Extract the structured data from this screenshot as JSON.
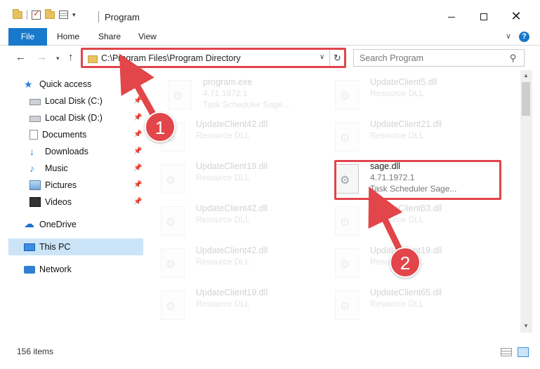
{
  "window": {
    "title": "Program",
    "close_glyph": "✕"
  },
  "ribbon": {
    "tabs": [
      "File",
      "Home",
      "Share",
      "View"
    ],
    "help": "?"
  },
  "navigation": {
    "address": "C:\\Program Files\\Program Directory",
    "search_placeholder": "Search Program"
  },
  "sidebar": {
    "items": [
      {
        "label": "Quick access",
        "icon": "star-icon"
      },
      {
        "label": "Local Disk (C:)",
        "icon": "disk-icon",
        "pinned": true
      },
      {
        "label": "Local Disk (D:)",
        "icon": "disk-icon",
        "pinned": true
      },
      {
        "label": "Documents",
        "icon": "documents-icon",
        "pinned": true
      },
      {
        "label": "Downloads",
        "icon": "download-icon",
        "pinned": true
      },
      {
        "label": "Music",
        "icon": "music-icon",
        "pinned": true
      },
      {
        "label": "Pictures",
        "icon": "pictures-icon",
        "pinned": true
      },
      {
        "label": "Videos",
        "icon": "videos-icon",
        "pinned": true
      },
      {
        "label": "OneDrive",
        "icon": "cloud-icon"
      },
      {
        "label": "This PC",
        "icon": "computer-icon",
        "selected": true
      },
      {
        "label": "Network",
        "icon": "network-icon"
      }
    ]
  },
  "files": [
    {
      "name": "program.exe",
      "version": "4.71.1972.1",
      "desc": "Task Scheduler Sage..."
    },
    {
      "name": "UpdateClient5.dll",
      "version": "Resource DLL",
      "desc": ""
    },
    {
      "name": "UpdateClient42.dll",
      "version": "Resource DLL",
      "desc": ""
    },
    {
      "name": "UpdateClient21.dll",
      "version": "Resource DLL",
      "desc": ""
    },
    {
      "name": "UpdateClient19.dll",
      "version": "Resource DLL",
      "desc": ""
    },
    {
      "name": "sage.dll",
      "version": "4.71.1972.1",
      "desc": "Task Scheduler Sage..."
    },
    {
      "name": "UpdateClient42.dll",
      "version": "Resource DLL",
      "desc": ""
    },
    {
      "name": "UpdateClient63.dll",
      "version": "Resource DLL",
      "desc": ""
    },
    {
      "name": "UpdateClient42.dll",
      "version": "Resource DLL",
      "desc": ""
    },
    {
      "name": "UpdateClient19.dll",
      "version": "Resource DLL",
      "desc": ""
    },
    {
      "name": "UpdateClient19.dll",
      "version": "Resource DLL",
      "desc": ""
    },
    {
      "name": "UpdateClient65.dll",
      "version": "Resource DLL",
      "desc": ""
    }
  ],
  "status": {
    "item_count": "156 items"
  },
  "callouts": [
    "1",
    "2"
  ],
  "colors": {
    "accent": "#1979ca",
    "highlight": "#e0444b"
  }
}
